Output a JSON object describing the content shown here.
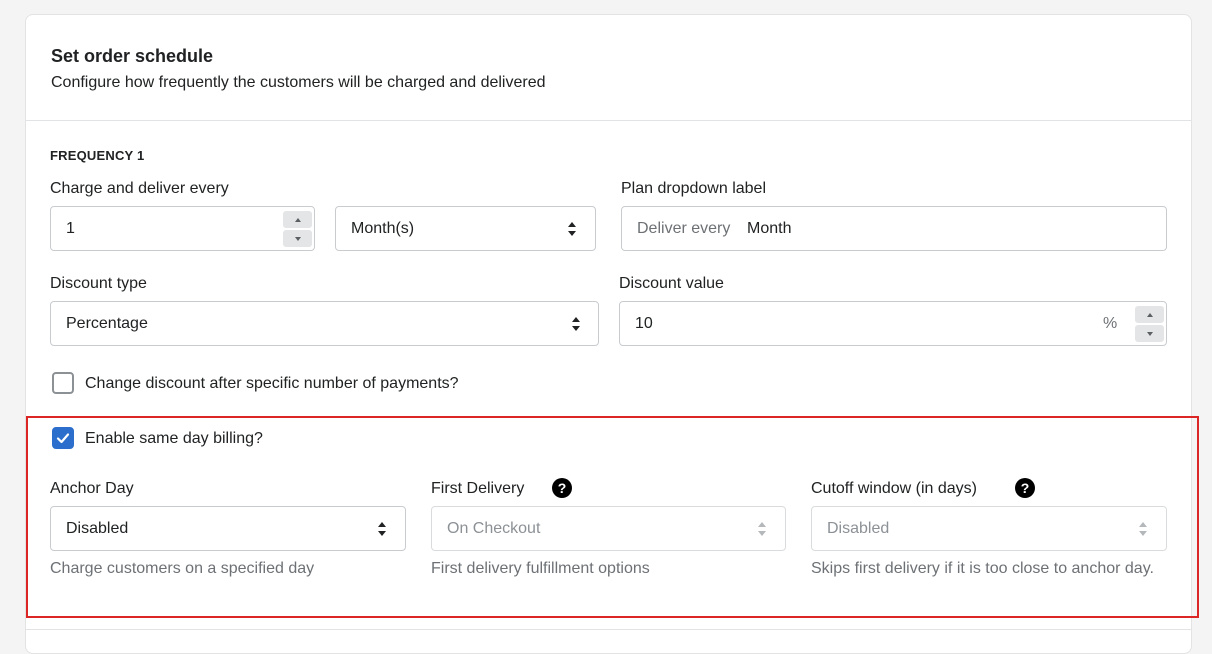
{
  "header": {
    "title": "Set order schedule",
    "subtitle": "Configure how frequently the customers will be charged and delivered"
  },
  "frequency": {
    "section_label": "FREQUENCY 1",
    "charge_label": "Charge and deliver every",
    "charge_value": "1",
    "interval_value": "Month(s)",
    "plan_label": "Plan dropdown label",
    "plan_prefix": "Deliver every",
    "plan_value": "Month",
    "discount_type_label": "Discount type",
    "discount_type_value": "Percentage",
    "discount_value_label": "Discount value",
    "discount_value": "10",
    "discount_unit": "%",
    "change_discount_label": "Change discount after specific number of payments?",
    "change_discount_checked": false
  },
  "same_day": {
    "enable_label": "Enable same day billing?",
    "enable_checked": true,
    "anchor_label": "Anchor Day",
    "anchor_value": "Disabled",
    "anchor_help": "Charge customers on a specified day",
    "first_delivery_label": "First Delivery",
    "first_delivery_value": "On Checkout",
    "first_delivery_help": "First delivery fulfillment options",
    "cutoff_label": "Cutoff window (in days)",
    "cutoff_value": "Disabled",
    "cutoff_help": "Skips first delivery if it is too close to anchor day.",
    "help_icon_glyph": "?"
  },
  "colors": {
    "accent": "#2c6ecb",
    "highlight": "#dc2626"
  },
  "icons": {
    "checkmark": "checkmark-icon",
    "help": "question-circle-icon",
    "select": "select-arrows-icon",
    "spinner": "stepper-arrows-icon"
  }
}
